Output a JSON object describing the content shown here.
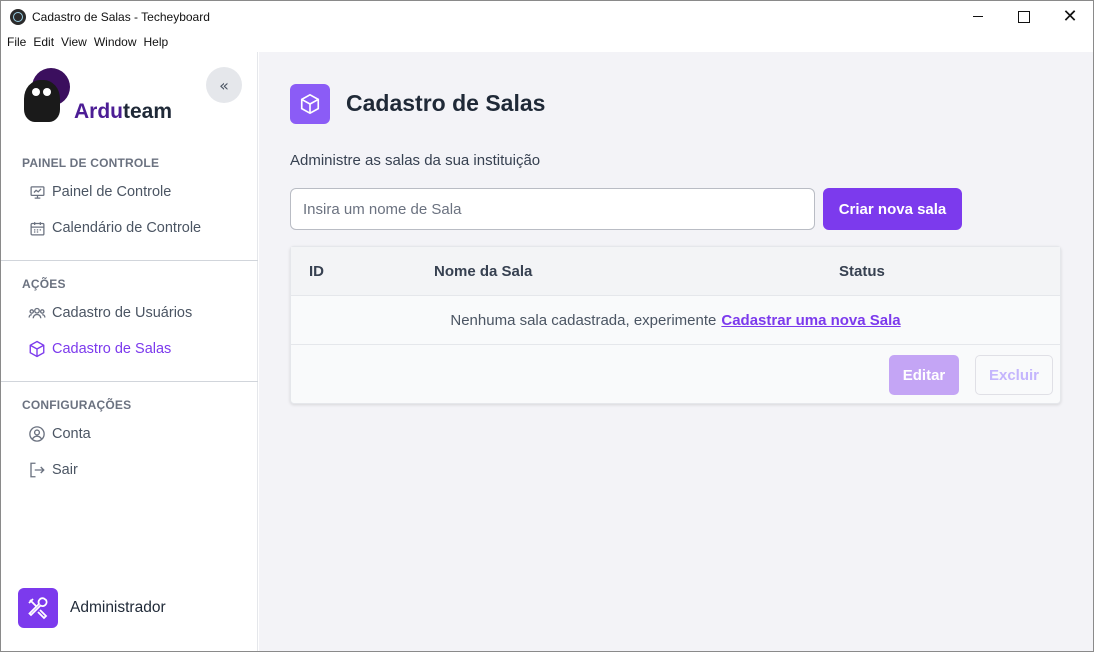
{
  "window": {
    "title": "Cadastro de Salas - Techeyboard",
    "close_glyph": "✕"
  },
  "menubar": {
    "items": [
      "File",
      "Edit",
      "View",
      "Window",
      "Help"
    ]
  },
  "sidebar": {
    "brand": {
      "prefix": "Ardu",
      "suffix": "team"
    },
    "collapse_glyph": "«",
    "sections": [
      {
        "label": "PAINEL DE CONTROLE",
        "items": [
          {
            "label": "Painel de Controle",
            "icon": "chart-presentation-icon"
          },
          {
            "label": "Calendário de Controle",
            "icon": "calendar-icon"
          }
        ]
      },
      {
        "label": "AÇÕES",
        "items": [
          {
            "label": "Cadastro de Usuários",
            "icon": "users-icon"
          },
          {
            "label": "Cadastro de Salas",
            "icon": "cube-icon",
            "active": true
          }
        ]
      },
      {
        "label": "CONFIGURAÇÕES",
        "items": [
          {
            "label": "Conta",
            "icon": "user-circle-icon"
          },
          {
            "label": "Sair",
            "icon": "logout-icon"
          }
        ]
      }
    ],
    "user": {
      "name": "Administrador",
      "icon": "tools-icon"
    }
  },
  "main": {
    "title": "Cadastro de Salas",
    "subtitle": "Administre as salas da sua instituição",
    "search": {
      "placeholder": "Insira um nome de Sala",
      "value": ""
    },
    "create_button": "Criar nova sala",
    "table": {
      "columns": [
        "ID",
        "Nome da Sala",
        "Status"
      ],
      "empty_text": "Nenhuma sala cadastrada, experimente",
      "empty_link": "Cadastrar uma nova Sala"
    },
    "edit_button": "Editar",
    "delete_button": "Excluir"
  },
  "colors": {
    "accent": "#7c3aed",
    "accent_light": "#8b5cf6",
    "main_bg": "#f3f3f7"
  }
}
